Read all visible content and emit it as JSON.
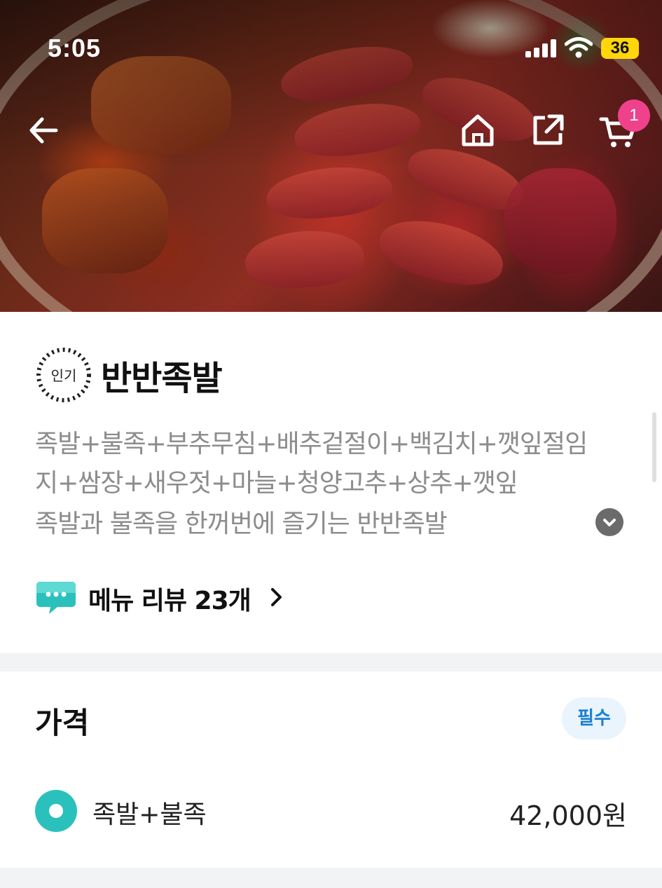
{
  "status_bar": {
    "time": "5:05",
    "battery": "36"
  },
  "nav": {
    "cart_count": "1",
    "icons": [
      "back-arrow-icon",
      "home-icon",
      "share-icon",
      "cart-icon"
    ]
  },
  "menu_item": {
    "badge": "인기",
    "name": "반반족발",
    "description_lines": [
      "족발+불족+부추무침+배추겉절이+백김치+깻잎절임",
      "지+쌈장+새우젓+마늘+청양고추+상추+깻잎",
      "족발과 불족을 한꺼번에 즐기는 반반족발"
    ],
    "review_link": "메뉴 리뷰 23개"
  },
  "price_section": {
    "heading": "가격",
    "required_label": "필수",
    "options": [
      {
        "label": "족발+불족",
        "price": "42,000원",
        "selected": true
      }
    ]
  },
  "colors": {
    "accent": "#2ac1bc",
    "badge_pink": "#f0418c",
    "required_blue": "#1a7fd1",
    "required_bg": "#e9f4fc",
    "divider": "#f2f3f5",
    "description_gray": "#8c8c8c"
  }
}
